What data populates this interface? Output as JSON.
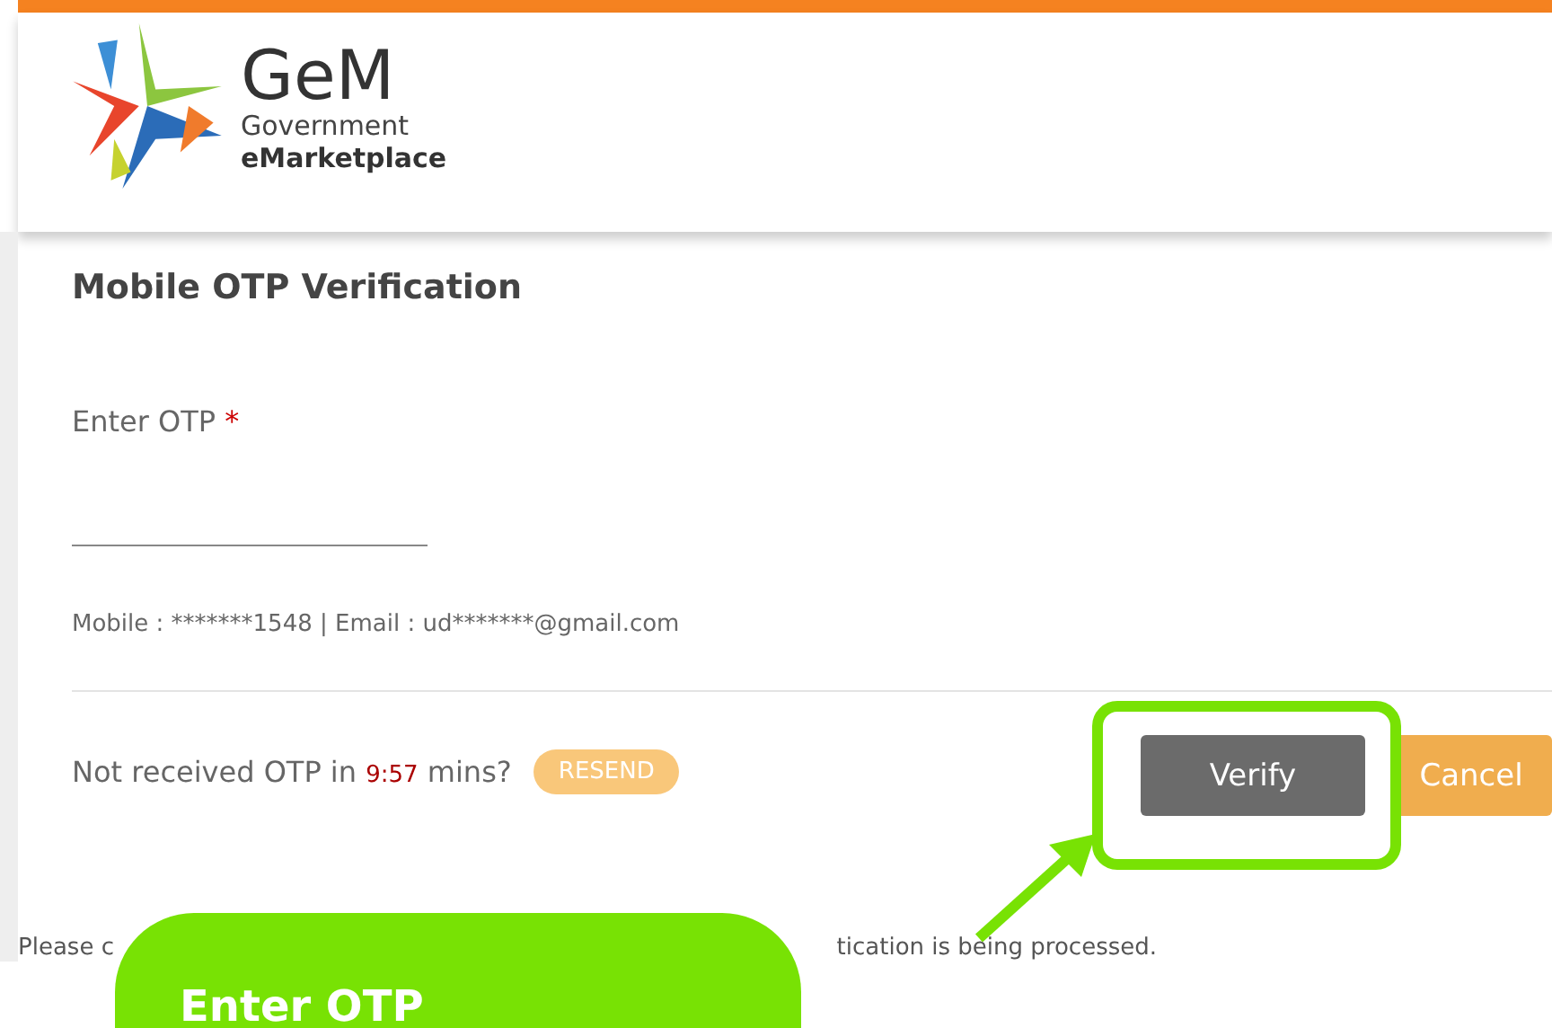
{
  "logo": {
    "title": "GeM",
    "line_1": "Government",
    "line_2": "eMarketplace"
  },
  "form": {
    "title": "Mobile OTP Verification",
    "otp_label": "Enter OTP",
    "required_mark": "*",
    "contact": "Mobile : *******1548 | Email : ud*******@gmail.com",
    "resend_before": "Not received OTP in",
    "timer": "9:57",
    "resend_after": "mins?",
    "resend_button": "RESEND",
    "buttons": [
      {
        "label": "Verify",
        "kind": "primary"
      },
      {
        "label": "Cancel",
        "kind": "secondary"
      }
    ],
    "note_start": "Please c",
    "note_end": "tication is being processed."
  },
  "callout": {
    "text": "Enter OTP"
  }
}
